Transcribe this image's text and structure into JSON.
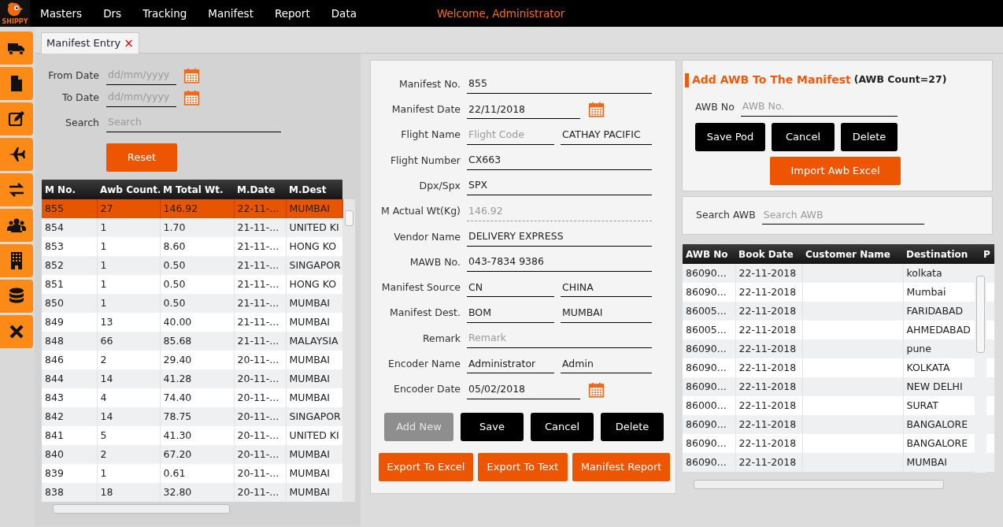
{
  "logo": {
    "text": "SHIPPY"
  },
  "menu": [
    {
      "label": "Masters"
    },
    {
      "label": "Drs"
    },
    {
      "label": "Tracking"
    },
    {
      "label": "Manifest"
    },
    {
      "label": "Report"
    },
    {
      "label": "Data"
    }
  ],
  "welcome": "Welcome,  Administrator",
  "tabs": [
    {
      "label": "Manifest Entry",
      "selected": true,
      "close": "×"
    }
  ],
  "filters": {
    "fields": [
      {
        "label": "From Date",
        "placeholder": "dd/mm/yyyy",
        "kind": "date"
      },
      {
        "label": "To Date",
        "placeholder": "dd/mm/yyyy",
        "kind": "date"
      },
      {
        "label": "Search",
        "placeholder": "Search",
        "kind": "text"
      }
    ],
    "reset_button": "Reset"
  },
  "manifest_table": {
    "columns": [
      "M No.",
      "Awb Count.",
      "M Total Wt.",
      "M.Date",
      "M.Dest"
    ],
    "rows": [
      {
        "cells": [
          "855",
          "27",
          "146.92",
          "22-11-...",
          "MUMBAI"
        ],
        "selected": true
      },
      {
        "cells": [
          "854",
          "1",
          "1.70",
          "21-11-...",
          "UNITED KI"
        ],
        "selected": false
      },
      {
        "cells": [
          "853",
          "1",
          "8.60",
          "21-11-...",
          "HONG KO"
        ],
        "selected": false
      },
      {
        "cells": [
          "852",
          "1",
          "0.50",
          "21-11-...",
          "SINGAPOR"
        ],
        "selected": false
      },
      {
        "cells": [
          "851",
          "1",
          "0.50",
          "21-11-...",
          "HONG KO"
        ],
        "selected": false
      },
      {
        "cells": [
          "850",
          "1",
          "0.50",
          "21-11-...",
          "MUMBAI"
        ],
        "selected": false
      },
      {
        "cells": [
          "849",
          "13",
          "40.00",
          "21-11-...",
          "MUMBAI"
        ],
        "selected": false
      },
      {
        "cells": [
          "848",
          "66",
          "85.68",
          "21-11-...",
          "MALAYSIA"
        ],
        "selected": false
      },
      {
        "cells": [
          "846",
          "2",
          "29.40",
          "20-11-...",
          "MUMBAI"
        ],
        "selected": false
      },
      {
        "cells": [
          "844",
          "14",
          "41.28",
          "20-11-...",
          "MUMBAI"
        ],
        "selected": false
      },
      {
        "cells": [
          "843",
          "4",
          "74.40",
          "20-11-...",
          "MUMBAI"
        ],
        "selected": false
      },
      {
        "cells": [
          "842",
          "14",
          "78.75",
          "20-11-...",
          "SINGAPOR"
        ],
        "selected": false
      },
      {
        "cells": [
          "841",
          "5",
          "41.30",
          "20-11-...",
          "UNITED KI"
        ],
        "selected": false
      },
      {
        "cells": [
          "840",
          "2",
          "67.20",
          "20-11-...",
          "MUMBAI"
        ],
        "selected": false
      },
      {
        "cells": [
          "839",
          "1",
          "0.61",
          "20-11-...",
          "MUMBAI"
        ],
        "selected": false
      },
      {
        "cells": [
          "838",
          "18",
          "32.80",
          "20-11-...",
          "MUMBAI"
        ],
        "selected": false
      }
    ]
  },
  "manifest_form": {
    "fields": [
      {
        "label": "Manifest No.",
        "kind": "text",
        "value": "855"
      },
      {
        "label": "Manifest Date",
        "kind": "date",
        "value": "22/11/2018"
      },
      {
        "label": "Flight Name",
        "kind": "pair",
        "parts": [
          {
            "placeholder": "Flight Code"
          },
          {
            "value": "CATHAY PACIFIC"
          }
        ]
      },
      {
        "label": "Flight Number",
        "kind": "text",
        "value": "CX663"
      },
      {
        "label": "Dpx/Spx",
        "kind": "text",
        "value": "SPX"
      },
      {
        "label": "M Actual Wt(Kg)",
        "kind": "readonly",
        "value": "146.92"
      },
      {
        "label": "Vendor Name",
        "kind": "text",
        "value": "DELIVERY EXPRESS"
      },
      {
        "label": "MAWB No.",
        "kind": "text",
        "value": "043-7834 9386"
      },
      {
        "label": "Manifest Source",
        "kind": "pair",
        "parts": [
          {
            "value": "CN"
          },
          {
            "value": "CHINA"
          }
        ]
      },
      {
        "label": "Manifest Dest.",
        "kind": "pair",
        "parts": [
          {
            "value": "BOM"
          },
          {
            "value": "MUMBAI"
          }
        ]
      },
      {
        "label": "Remark",
        "kind": "text",
        "placeholder": "Remark"
      },
      {
        "label": "Encoder Name",
        "kind": "pair",
        "parts": [
          {
            "value": "Administrator"
          },
          {
            "value": "Admin"
          }
        ]
      },
      {
        "label": "Encoder Date",
        "kind": "date",
        "value": "05/02/2018"
      }
    ],
    "buttons": [
      {
        "label": "Add New",
        "disabled": true
      },
      {
        "label": "Save",
        "disabled": false
      },
      {
        "label": "Cancel",
        "disabled": false
      },
      {
        "label": "Delete",
        "disabled": false
      }
    ],
    "export_buttons": [
      "Export To Excel",
      "Export To Text",
      "Manifest Report"
    ]
  },
  "awb_panel": {
    "title": "Add AWB To The Manifest",
    "count": "(AWB Count=27)",
    "field": {
      "label": "AWB No",
      "placeholder": "AWB No."
    },
    "buttons": [
      "Save Pod",
      "Cancel",
      "Delete"
    ],
    "import_button": "Import Awb Excel"
  },
  "awb_search": {
    "label": "Search AWB",
    "placeholder": "Search AWB"
  },
  "awb_table": {
    "columns": [
      "AWB No",
      "Book Date",
      "Customer Name",
      "Destination",
      "P"
    ],
    "rows": [
      [
        "86090...",
        "22-11-2018",
        "",
        "kolkata"
      ],
      [
        "86090...",
        "22-11-2018",
        "",
        "Mumbai"
      ],
      [
        "86005...",
        "22-11-2018",
        "",
        "FARIDABAD"
      ],
      [
        "86005...",
        "22-11-2018",
        "",
        "AHMEDABAD"
      ],
      [
        "86090...",
        "22-11-2018",
        "",
        "pune"
      ],
      [
        "86090...",
        "22-11-2018",
        "",
        "KOLKATA"
      ],
      [
        "86090...",
        "22-11-2018",
        "",
        "NEW DELHI"
      ],
      [
        "86000...",
        "22-11-2018",
        "",
        "SURAT"
      ],
      [
        "86090...",
        "22-11-2018",
        "",
        "BANGALORE"
      ],
      [
        "86090...",
        "22-11-2018",
        "",
        "BANGALORE"
      ],
      [
        "86090...",
        "22-11-2018",
        "",
        "MUMBAI"
      ]
    ]
  }
}
